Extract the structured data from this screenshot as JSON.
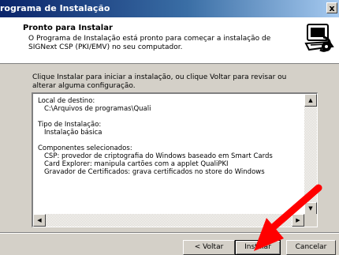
{
  "window": {
    "title": "rograma de Instalação",
    "close_label": "x"
  },
  "header": {
    "title": "Pronto para Instalar",
    "description": "O Programa de Instalação está pronto para começar a instalação de SIGNext CSP (PKI/EMV) no seu computador."
  },
  "instruction": "Clique Instalar para iniciar a instalação, ou clique Voltar para revisar ou alterar alguma configuração.",
  "summary": {
    "destination_label": "Local de destino:",
    "destination_value": "C:\\Arquivos de programas\\Quali",
    "type_label": "Tipo de Instalação:",
    "type_value": "Instalação básica",
    "components_label": "Componentes selecionados:",
    "components": [
      "CSP: provedor de criptografia do Windows baseado em Smart Cards",
      "Card Explorer: manipula cartões com a applet QualiPKI",
      "Gravador de Certificados: grava certificados no store do Windows"
    ]
  },
  "buttons": {
    "back": "< Voltar",
    "install": "Instalar",
    "cancel": "Cancelar"
  },
  "colors": {
    "annotation_arrow": "#ff0000",
    "titlebar": "#0a246a"
  }
}
